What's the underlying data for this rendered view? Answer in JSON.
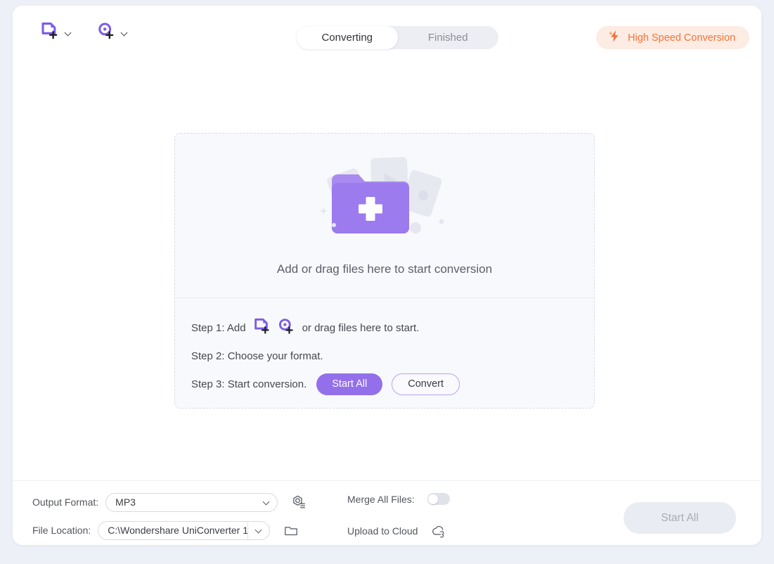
{
  "header": {
    "tools": [
      {
        "name": "add-files-tool",
        "icon": "add-file-icon",
        "caret": "chevron-down-icon"
      },
      {
        "name": "add-disc-tool",
        "icon": "add-disc-icon",
        "caret": "chevron-down-icon"
      }
    ],
    "tabs": [
      {
        "label": "Converting",
        "active": true
      },
      {
        "label": "Finished",
        "active": false
      }
    ],
    "high_speed": {
      "label": "High Speed Conversion",
      "icon": "lightning-bolt-icon",
      "text_color": "#f4733a",
      "bg_color": "#fdece3"
    }
  },
  "dropzone": {
    "illustration": "folder-plus-illustration",
    "prompt": "Add or drag files here to start conversion",
    "steps": {
      "step1_prefix": "Step 1: Add",
      "step1_suffix": "or drag files here to start.",
      "step2": "Step 2: Choose your format.",
      "step3": "Step 3: Start conversion.",
      "start_all_label": "Start All",
      "convert_label": "Convert"
    }
  },
  "bottom": {
    "output_format_label": "Output Format:",
    "output_format_value": "MP3",
    "file_location_label": "File Location:",
    "file_location_value": "C:\\Wondershare UniConverter 1",
    "merge_label": "Merge All Files:",
    "merge_enabled": false,
    "upload_label": "Upload to Cloud",
    "start_all_label": "Start All",
    "settings_icon": "format-settings-icon",
    "folder_icon": "folder-icon",
    "cloud_icon": "cloud-upload-icon"
  },
  "colors": {
    "accent_purple": "#9370ea",
    "orange": "#f4733a",
    "page_bg": "#eef0f8"
  }
}
